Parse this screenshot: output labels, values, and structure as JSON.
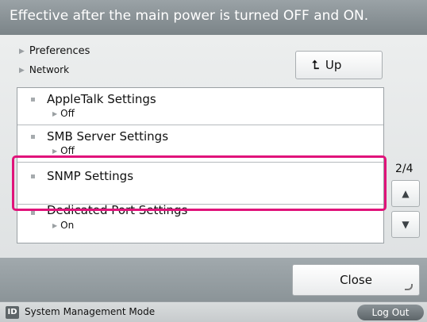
{
  "header": {
    "message": "Effective after the main power is turned OFF and ON."
  },
  "breadcrumb": {
    "level1": "Preferences",
    "level2": "Network"
  },
  "up_button": {
    "label": "Up",
    "icon": "up-arrow-icon"
  },
  "list": {
    "items": [
      {
        "label": "AppleTalk Settings",
        "value": "Off"
      },
      {
        "label": "SMB Server Settings",
        "value": "Off"
      },
      {
        "label": "SNMP Settings",
        "value": ""
      },
      {
        "label": "Dedicated Port Settings",
        "value": "On"
      }
    ]
  },
  "pager": {
    "page": "2/4",
    "up_icon": "triangle-up-icon",
    "down_icon": "triangle-down-icon"
  },
  "footer": {
    "close_label": "Close"
  },
  "status_bar": {
    "id_icon_text": "ID",
    "mode": "System Management Mode",
    "logout_label": "Log Out"
  },
  "colors": {
    "highlight": "#e0137a",
    "title_bar": "#8a9296"
  }
}
